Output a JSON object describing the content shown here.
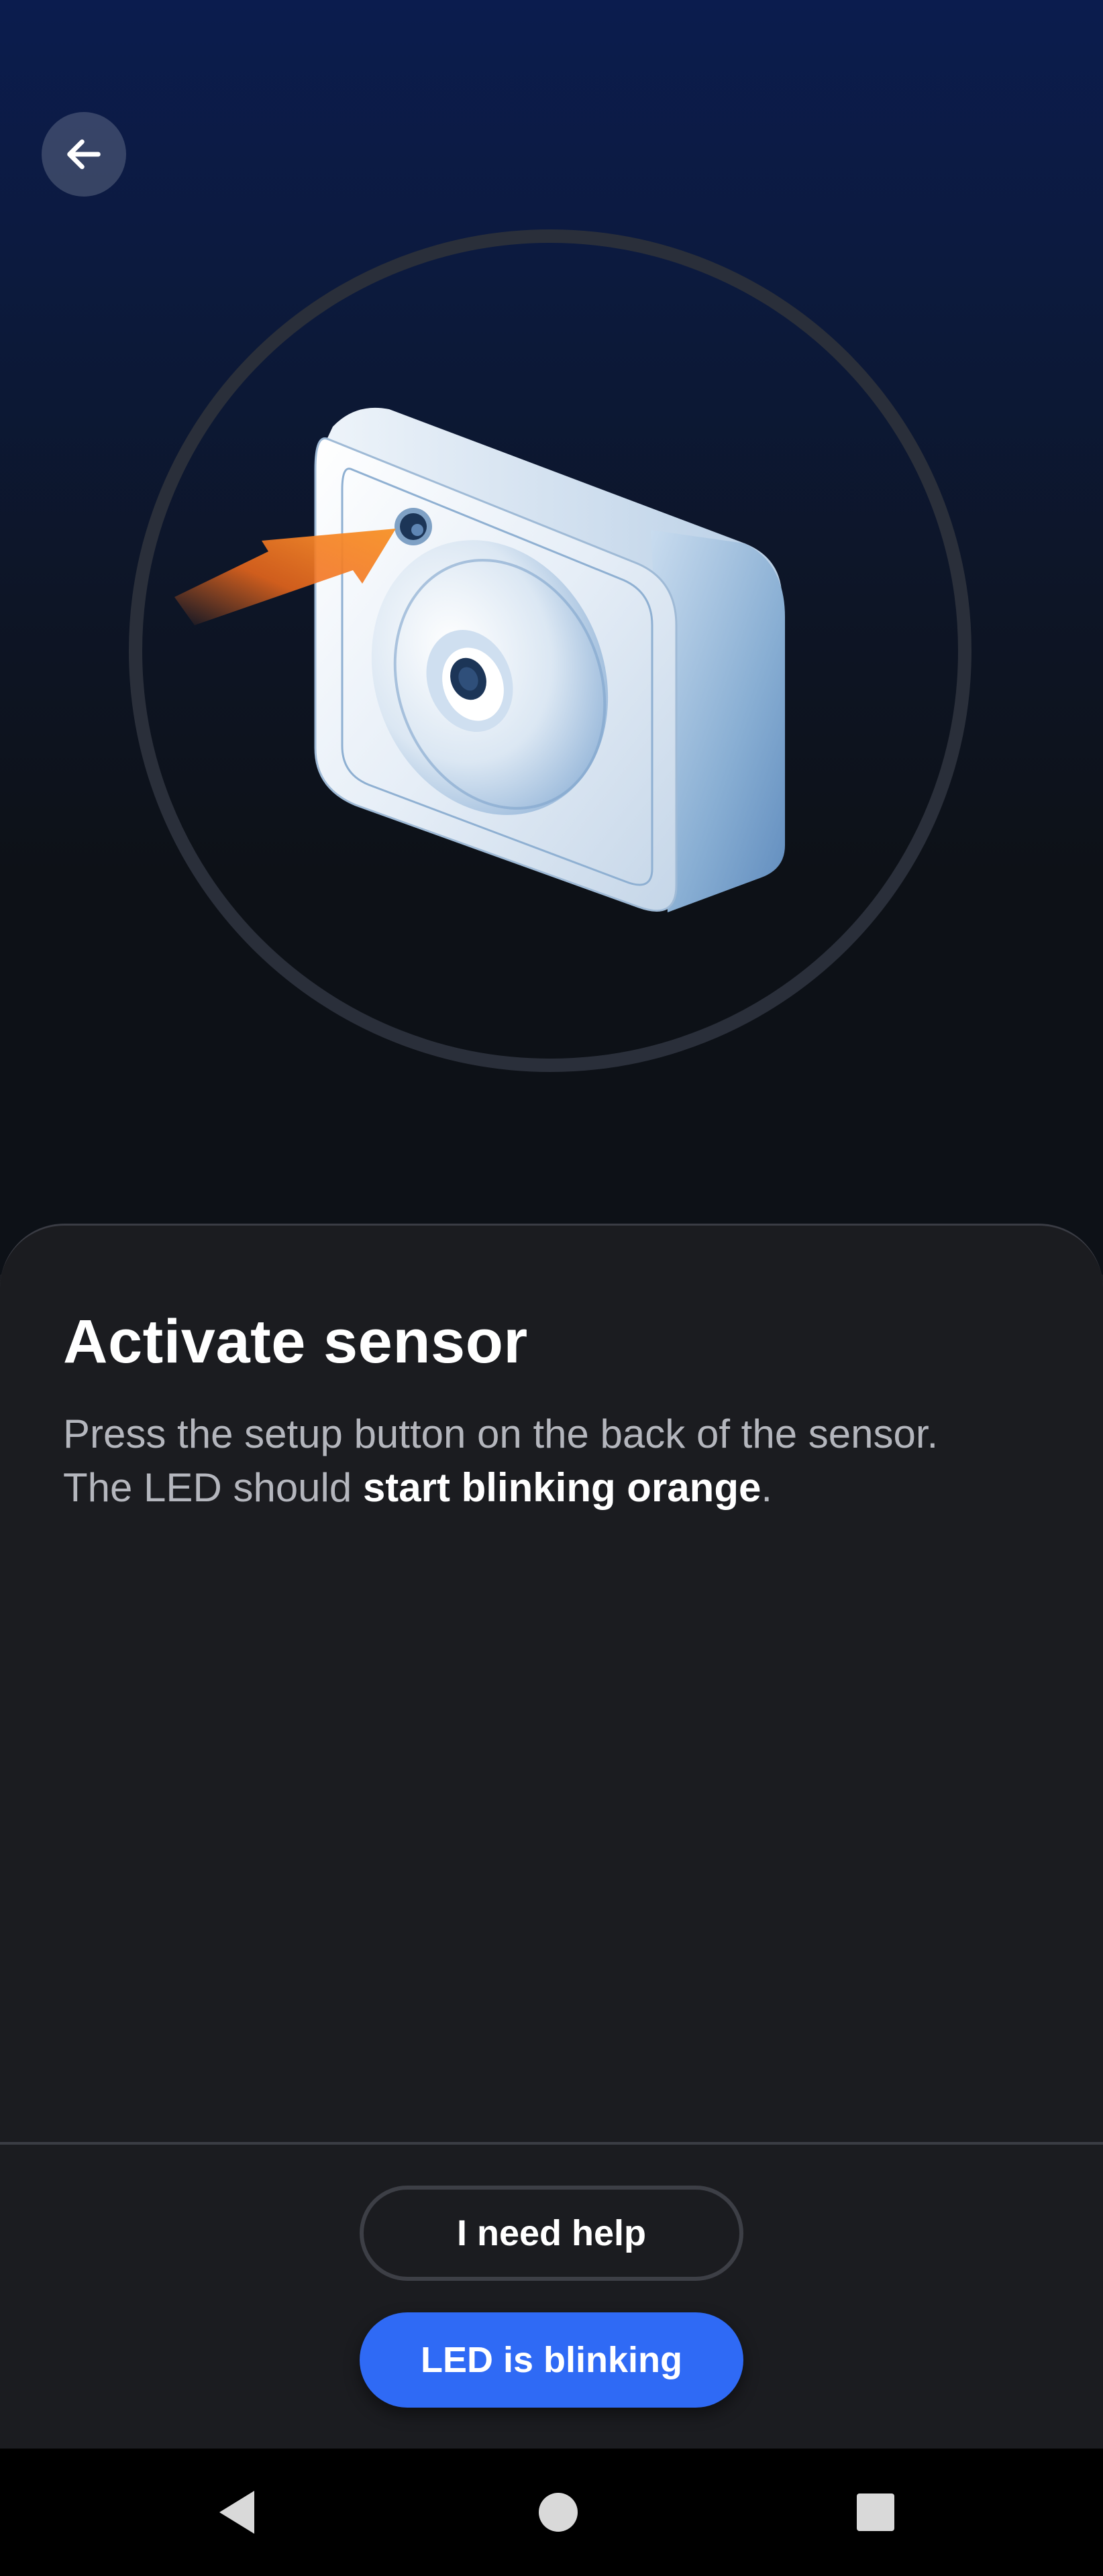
{
  "header": {
    "back_icon": "arrow-left-icon"
  },
  "illustration": {
    "subject": "sensor-device-illustration",
    "pointer_icon": "arrow-pointer-icon",
    "accent_color": "#f26a1b",
    "ring_color": "#2a2f3a"
  },
  "content": {
    "title": "Activate sensor",
    "instruction_line1": "Press the setup button on the back of the sensor.",
    "instruction_line2_prefix": "The LED should ",
    "instruction_line2_emphasis": "start blinking orange",
    "instruction_line2_suffix": "."
  },
  "actions": {
    "help_label": "I need help",
    "confirm_label": "LED is blinking",
    "primary_color": "#2f6af5"
  },
  "system_nav": {
    "back": "triangle-back-icon",
    "home": "circle-home-icon",
    "recents": "square-recents-icon"
  }
}
